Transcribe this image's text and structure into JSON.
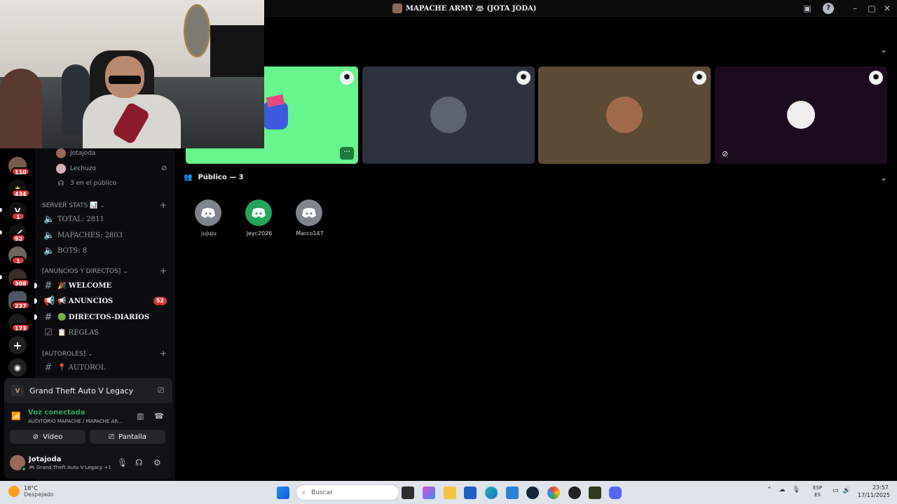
{
  "window": {
    "title": "MAPACHE ARMY 🦝 (JOTA JODA)"
  },
  "server_rail": {
    "badges": [
      "110",
      "434",
      "1",
      "92",
      "1",
      "308",
      "237",
      "173"
    ],
    "add_server_icon": "plus-icon",
    "discover_icon": "compass-icon"
  },
  "voice_channel_users": [
    "Jotajoda",
    "Lechuzo",
    "3 en el público"
  ],
  "categories": {
    "server_stats": "SERVER STATS 📊",
    "anuncios": "[ANUNCIOS Y DIRECTOS]",
    "autoroles": "[AUTOROLES]"
  },
  "stats": {
    "total": "TOTAL: 2811",
    "mapaches": "MAPACHES: 2803",
    "bots": "BOTS: 8"
  },
  "channels": [
    {
      "label": "🎉 WELCOME",
      "badge": ""
    },
    {
      "label": "📢 ANUNCIOS",
      "badge": "52"
    },
    {
      "label": "🟢 DIRECTOS-DIARIOS",
      "badge": ""
    },
    {
      "label": "📋 REGLAS",
      "badge": ""
    },
    {
      "label": "📍 AUTOROL",
      "badge": ""
    }
  ],
  "activity": {
    "game": "Grand Theft Auto V Legacy"
  },
  "voice": {
    "status": "Voz conectada",
    "location": "AUDITORIO MAPACHE / MAPACHE AR...",
    "video_label": "Vídeo",
    "screen_label": "Pantalla"
  },
  "user": {
    "name": "Jotajoda",
    "status": "🎮 Grand Theft Auto V Legacy +1"
  },
  "audience": {
    "header": "Público — 3",
    "members": [
      "jujuju",
      "Jeyc2026",
      "Marco147"
    ]
  },
  "taskbar": {
    "temperature": "18°C",
    "weather": "Despejado",
    "search_placeholder": "Buscar",
    "lang_top": "ESP",
    "lang_bottom": "ES",
    "time": "23:57",
    "date": "17/11/2025"
  },
  "colors": {
    "accent_green": "#23a55a",
    "badge_red": "#da373c",
    "tile_speaking": "#67f58e",
    "tile_dark": "#2e3140",
    "tile_brown": "#5c4a34",
    "tile_purple": "#1c0b1e"
  }
}
